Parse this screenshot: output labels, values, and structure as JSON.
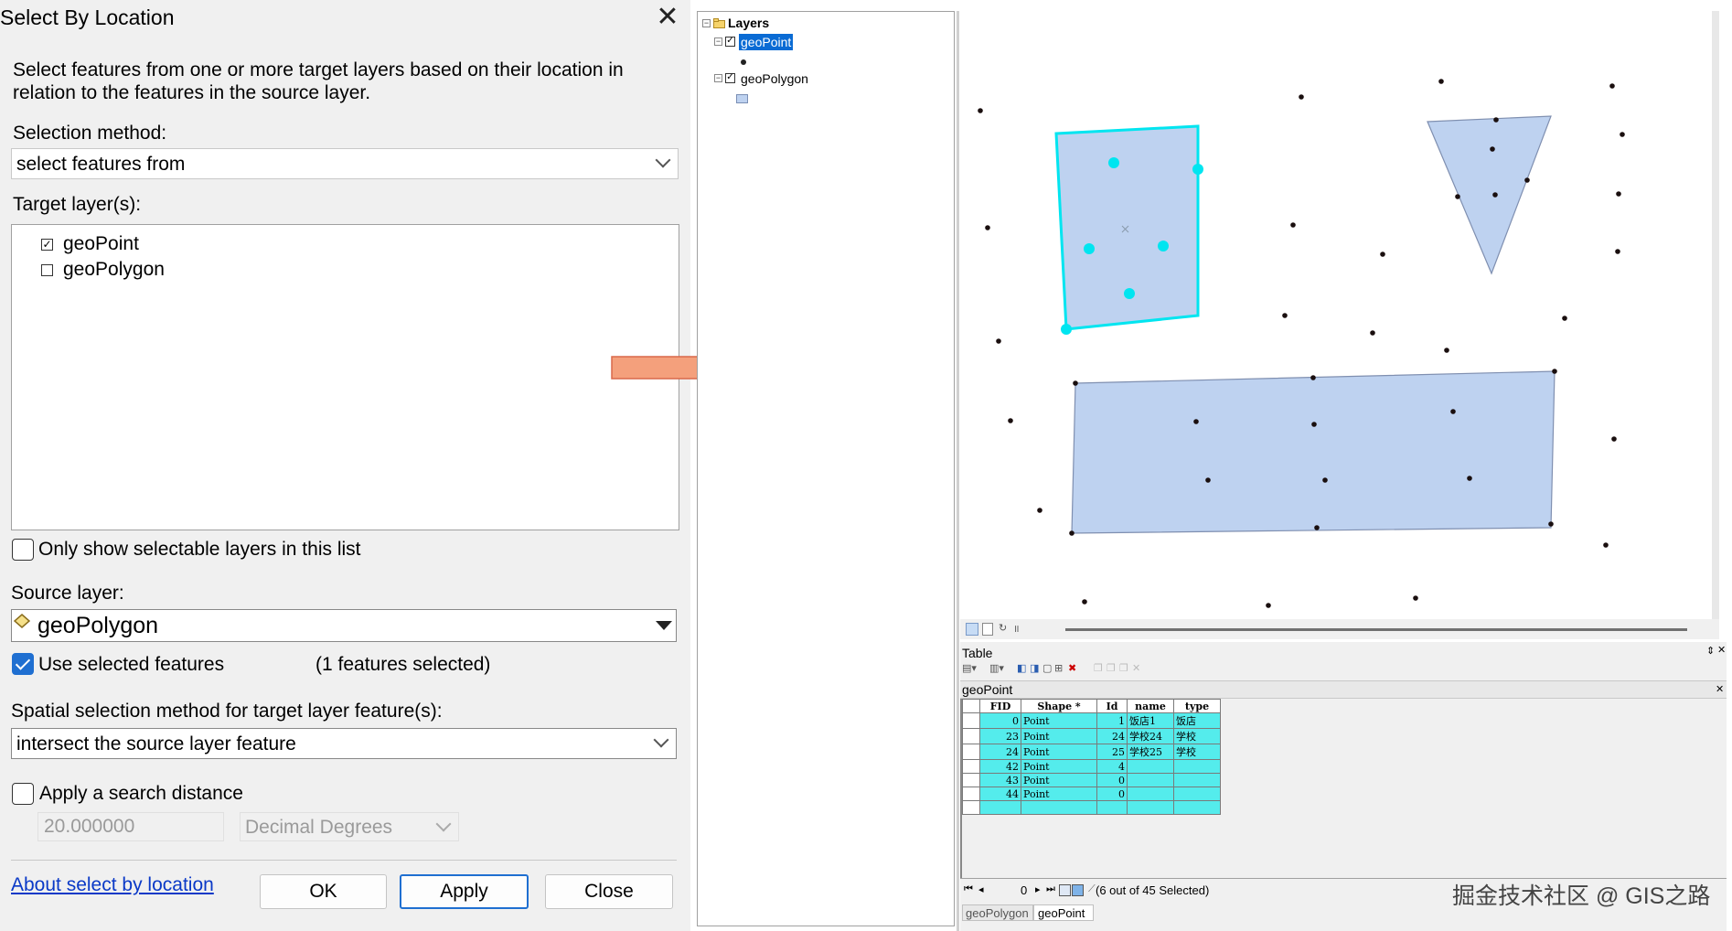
{
  "dialog": {
    "title": "Select By Location",
    "description": "Select features from one or more target layers based on their location in relation to the features in the source layer.",
    "selection_method_label": "Selection method:",
    "selection_method_value": "select features from",
    "target_layers_label": "Target layer(s):",
    "target_layers": [
      {
        "name": "geoPoint",
        "checked": true
      },
      {
        "name": "geoPolygon",
        "checked": false
      }
    ],
    "only_selectable_label": "Only show selectable layers in this list",
    "source_layer_label": "Source layer:",
    "source_layer_value": "geoPolygon",
    "use_selected_label": "Use selected features",
    "features_selected": "(1 features selected)",
    "spatial_method_label": "Spatial selection method for target layer feature(s):",
    "spatial_method_value": "intersect the source layer feature",
    "search_distance_label": "Apply a search distance",
    "search_distance_value": "20.000000",
    "search_distance_unit": "Decimal Degrees",
    "about_link": "About select by location",
    "ok_label": "OK",
    "apply_label": "Apply",
    "close_label": "Close"
  },
  "toc": {
    "root": "Layers",
    "layers": [
      {
        "name": "geoPoint",
        "selected": true
      },
      {
        "name": "geoPolygon",
        "selected": false
      }
    ]
  },
  "table": {
    "panel_title": "Table",
    "tab_title": "geoPoint",
    "columns": [
      "FID",
      "Shape *",
      "Id",
      "name",
      "type"
    ],
    "rows": [
      [
        "0",
        "Point",
        "1",
        "饭店1",
        "饭店"
      ],
      [
        "23",
        "Point",
        "24",
        "学校24",
        "学校"
      ],
      [
        "24",
        "Point",
        "25",
        "学校25",
        "学校"
      ],
      [
        "42",
        "Point",
        "4",
        "",
        ""
      ],
      [
        "43",
        "Point",
        "0",
        "",
        ""
      ],
      [
        "44",
        "Point",
        "0",
        "",
        ""
      ]
    ],
    "record_number": "0",
    "selection_status": "(6 out of 45 Selected)",
    "bottom_tabs": [
      "geoPolygon",
      "geoPoint"
    ]
  },
  "watermark": "掘金技术社区 @ GIS之路",
  "colors": {
    "selection": "#00ffff",
    "polygon_fill": "#bed2f0",
    "arrow": "#f4a07c",
    "accent": "#1f6fd1"
  }
}
